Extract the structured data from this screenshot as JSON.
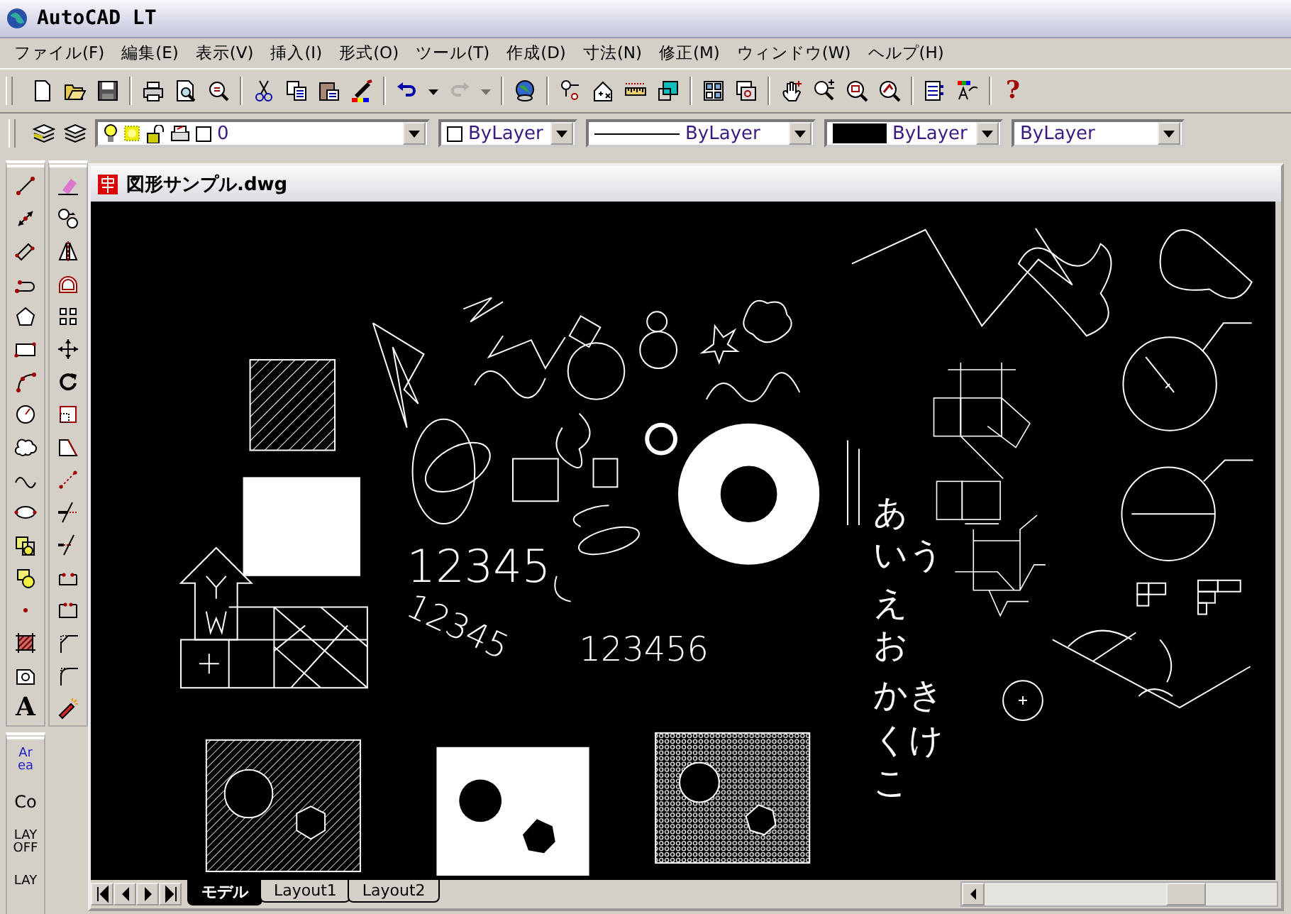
{
  "window": {
    "title": "AutoCAD LT"
  },
  "menu": [
    {
      "label": "ファイル(F)"
    },
    {
      "label": "編集(E)"
    },
    {
      "label": "表示(V)"
    },
    {
      "label": "挿入(I)"
    },
    {
      "label": "形式(O)"
    },
    {
      "label": "ツール(T)"
    },
    {
      "label": "作成(D)"
    },
    {
      "label": "寸法(N)"
    },
    {
      "label": "修正(M)"
    },
    {
      "label": "ウィンドウ(W)"
    },
    {
      "label": "ヘルプ(H)"
    }
  ],
  "standard_toolbar": {
    "help": "?"
  },
  "layer_toolbar": {
    "layer": "0"
  },
  "properties": [
    {
      "kind": "swatch-outline",
      "value": "ByLayer"
    },
    {
      "kind": "line",
      "value": "ByLayer"
    },
    {
      "kind": "swatch-filled",
      "value": "ByLayer"
    },
    {
      "kind": "plain",
      "value": "ByLayer"
    }
  ],
  "draw_toolbar": {
    "text_tool": "A"
  },
  "extra_toolbar": [
    "Area",
    "Co",
    "LAY OFF",
    "LAY"
  ],
  "document": {
    "title": "図形サンプル.dwg",
    "texts": [
      {
        "kind": "large",
        "text": "12345"
      },
      {
        "kind": "rotated",
        "text": "12345"
      },
      {
        "kind": "small",
        "text": "123456"
      }
    ],
    "japanese_lines": [
      "あ",
      "いう",
      "え",
      "お",
      "かき",
      "くけ",
      "こ"
    ],
    "tabs": [
      {
        "label": "モデル",
        "selected": true
      },
      {
        "label": "Layout1",
        "selected": false
      },
      {
        "label": "Layout2",
        "selected": false
      }
    ]
  }
}
